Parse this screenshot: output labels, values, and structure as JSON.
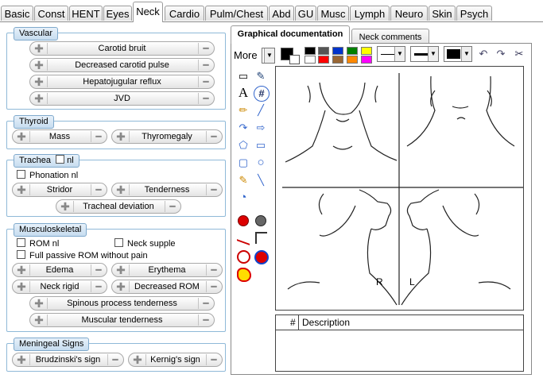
{
  "tabs": [
    "Basic",
    "Const",
    "HENT",
    "Eyes",
    "Neck",
    "Cardio",
    "Pulm/Chest",
    "Abd",
    "GU",
    "Musc",
    "Lymph",
    "Neuro",
    "Skin",
    "Psych"
  ],
  "active_tab": "Neck",
  "vascular": {
    "title": "Vascular",
    "items": [
      "Carotid bruit",
      "Decreased carotid pulse",
      "Hepatojugular reflux",
      "JVD"
    ]
  },
  "thyroid": {
    "title": "Thyroid",
    "items": [
      "Mass",
      "Thyromegaly"
    ]
  },
  "trachea": {
    "title": "Trachea",
    "nl_label": "nl",
    "phonation": "Phonation nl",
    "items": [
      "Stridor",
      "Tenderness",
      "Tracheal deviation"
    ]
  },
  "musculoskeletal": {
    "title": "Musculoskeletal",
    "rom_nl": "ROM nl",
    "neck_supple": "Neck supple",
    "full_rom": "Full passive ROM without pain",
    "items": [
      "Edema",
      "Erythema",
      "Neck rigid",
      "Decreased ROM",
      "Spinous process tenderness",
      "Muscular tenderness"
    ]
  },
  "meningeal": {
    "title": "Meningeal Signs",
    "items": [
      "Brudzinski's sign",
      "Kernig's sign"
    ]
  },
  "right_tabs": [
    "Graphical documentation",
    "Neck comments"
  ],
  "toolbar": {
    "more_label": "More"
  },
  "palette": [
    "#000000",
    "#555555",
    "#0033cc",
    "#008000",
    "#ffff00",
    "#ffffff",
    "#ff0000",
    "#996633",
    "#ff8800",
    "#ff00ff"
  ],
  "icons": {
    "undo": "↶",
    "redo": "↷",
    "cut": "✂"
  },
  "tools": [
    "▭",
    "✎",
    "A",
    "#",
    "✏",
    "╱",
    "↷",
    "⇨",
    "⬠",
    "▭",
    "▢",
    "○",
    "✎",
    "╲",
    "◔"
  ],
  "canvas": {
    "label_r": "R",
    "label_l": "L"
  },
  "table": {
    "col_num": "#",
    "col_desc": "Description"
  }
}
